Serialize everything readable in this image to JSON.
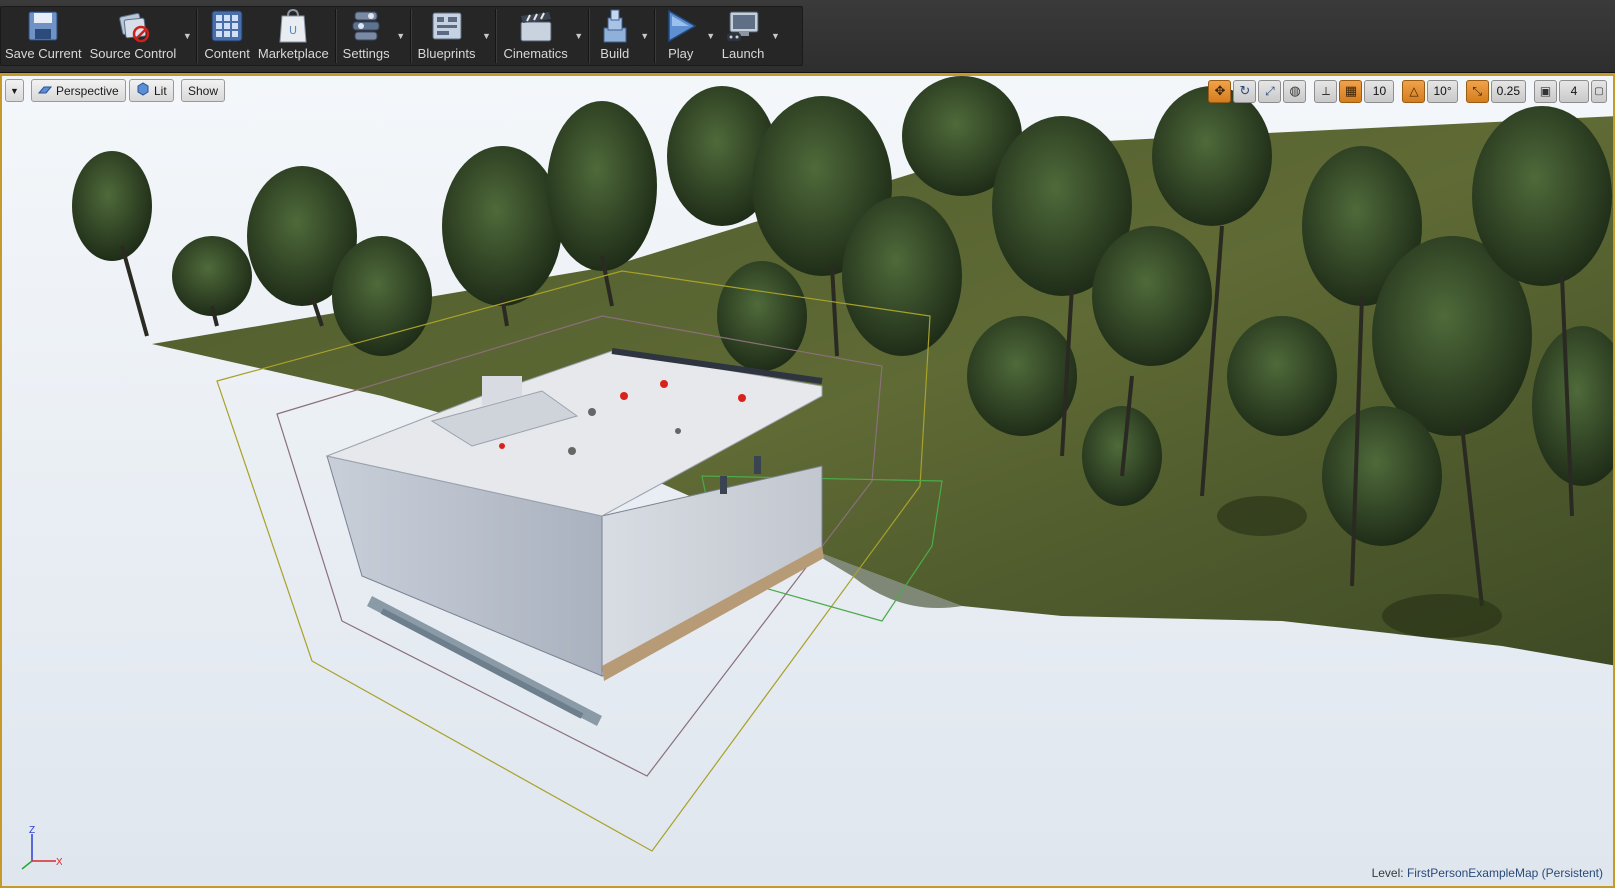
{
  "toolbar": {
    "buttons": [
      {
        "label": "Save Current",
        "icon": "floppy-disk-icon",
        "caret": false
      },
      {
        "label": "Source Control",
        "icon": "source-control-icon",
        "caret": true
      },
      {
        "label": "Content",
        "icon": "content-grid-icon",
        "caret": false
      },
      {
        "label": "Marketplace",
        "icon": "marketplace-bag-icon",
        "caret": false
      },
      {
        "label": "Settings",
        "icon": "settings-gears-icon",
        "caret": true
      },
      {
        "label": "Blueprints",
        "icon": "blueprint-icon",
        "caret": true
      },
      {
        "label": "Cinematics",
        "icon": "clapperboard-icon",
        "caret": true
      },
      {
        "label": "Build",
        "icon": "build-blocks-icon",
        "caret": true
      },
      {
        "label": "Play",
        "icon": "play-icon",
        "caret": true
      },
      {
        "label": "Launch",
        "icon": "launch-monitor-icon",
        "caret": true
      }
    ]
  },
  "viewport": {
    "left_controls": {
      "perspective_label": "Perspective",
      "lit_label": "Lit",
      "show_label": "Show"
    },
    "right_controls": {
      "grid_snap_value": "10",
      "rotation_snap_value": "10°",
      "scale_snap_value": "0.25",
      "camera_speed_value": "4"
    },
    "level": {
      "prefix": "Level:",
      "name": "FirstPersonExampleMap (Persistent)"
    },
    "axis": {
      "z": "Z",
      "x": "X"
    }
  },
  "colors": {
    "accent": "#c59a2a",
    "toolbar_bg": "#2e2e2e",
    "active_toggle": "#e08a2a"
  }
}
